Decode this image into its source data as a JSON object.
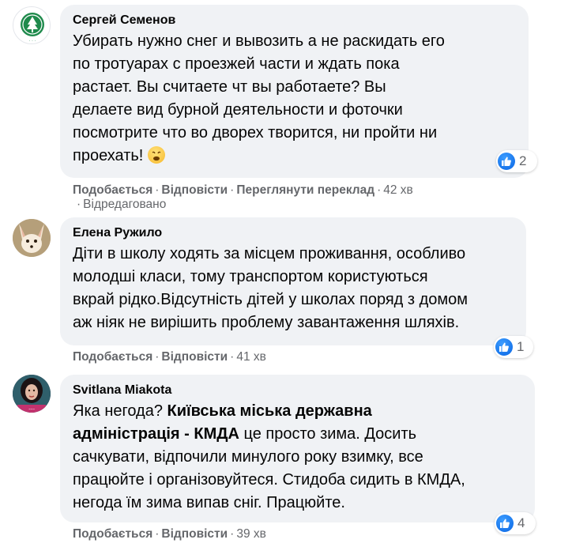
{
  "comments": [
    {
      "author": "Сергей Семенов",
      "avatar": "green-seal-logo",
      "text": "Убирать нужно снег и вывозить а не раскидать его\nпо тротуарах с проезжей части и ждать пока\nрастает. Вы считаете чт вы работаете? Вы\nделаете вид бурной деятельности и фоточки\nпосмотрите что во дворех творится, ни пройти ни\nпроехать! ",
      "emoji": "weary-face",
      "reaction_count": "2",
      "actions": {
        "like": "Подобається",
        "reply": "Відповісти",
        "translate": "Переглянути переклад",
        "time": "42 хв",
        "edited": "Відредаговано"
      }
    },
    {
      "author": "Елена Ружило",
      "avatar": "fox-photo",
      "text": "Діти в школу ходять за місцем проживання, особливо\nмолодші класи, тому транспортом користуються\nвкрай рідко.Відсутність дітей у школах поряд з домом\nаж ніяк не вирішить проблему завантаження шляхів.",
      "reaction_count": "1",
      "actions": {
        "like": "Подобається",
        "reply": "Відповісти",
        "time": "41 хв"
      }
    },
    {
      "author": "Svitlana Miakota",
      "avatar": "profile-photo",
      "text_prefix": "Яка негода? ",
      "mention": "Київська міська державна\nадміністрація - КМДА",
      "text_suffix": " це просто зима. Досить\nсачкувати, відпочили минулого року взимку, все\nпрацюйте і організовуйтеся. Стидоба сидить в КМДА,\nнегода їм зима випав сніг. Працюйте.",
      "reaction_count": "4",
      "actions": {
        "like": "Подобається",
        "reply": "Відповісти",
        "time": "39 хв"
      }
    }
  ],
  "colors": {
    "bubble": "#f0f2f5",
    "meta": "#65676b",
    "like": "#1877f2",
    "seal_green": "#1f8a4c"
  }
}
